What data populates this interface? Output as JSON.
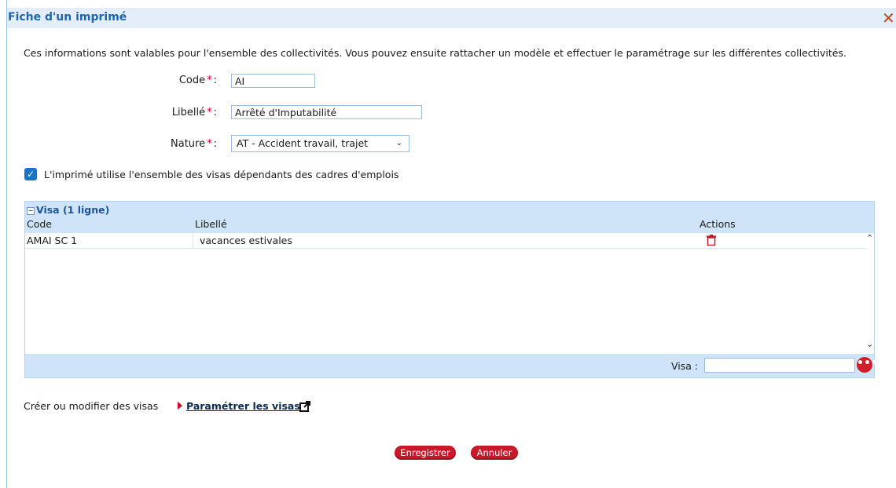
{
  "window": {
    "title": "Fiche d'un imprimé",
    "close_icon": "close-x-icon"
  },
  "intro_text": "Ces informations sont valables pour l'ensemble des collectivités. Vous pouvez ensuite rattacher un modèle et effectuer le paramétrage sur les différentes collectivités.",
  "form": {
    "code_label": "Code",
    "code_value": "AI",
    "libelle_label": "Libellé",
    "libelle_value": "Arrêté d'Imputabilité",
    "nature_label": "Nature",
    "nature_value": "AT - Accident travail, trajet",
    "required_marker": "*",
    "colon": ":",
    "checkbox_checked": true,
    "checkbox_label": "L'imprimé utilise l'ensemble des visas dépendants des cadres d'emplois"
  },
  "grid": {
    "title": "Visa (1 ligne)",
    "columns": [
      "Code",
      "Libellé",
      "Actions"
    ],
    "rows": [
      {
        "code": "AMAI SC 1",
        "libelle": "vacances estivales"
      }
    ],
    "footer_label": "Visa :",
    "footer_input": ""
  },
  "links": {
    "create_text": "Créer ou modifier des visas",
    "param_link": "Paramétrer les visas"
  },
  "buttons": {
    "save": "Enregistrer",
    "cancel": "Annuler"
  },
  "colors": {
    "accent": "#1d64b4",
    "header_bg": "#cfe4f8",
    "button": "#c9182a"
  }
}
